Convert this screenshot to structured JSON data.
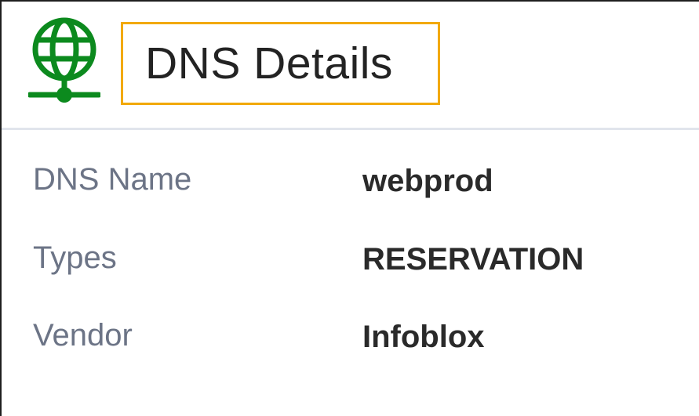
{
  "header": {
    "icon": "dns-network-globe-icon",
    "icon_color": "#0c8a1e",
    "title": "DNS Details",
    "highlight_color": "#f2a900"
  },
  "details": [
    {
      "label": "DNS Name",
      "value": "webprod"
    },
    {
      "label": "Types",
      "value": "RESERVATION"
    },
    {
      "label": "Vendor",
      "value": "Infoblox"
    }
  ]
}
